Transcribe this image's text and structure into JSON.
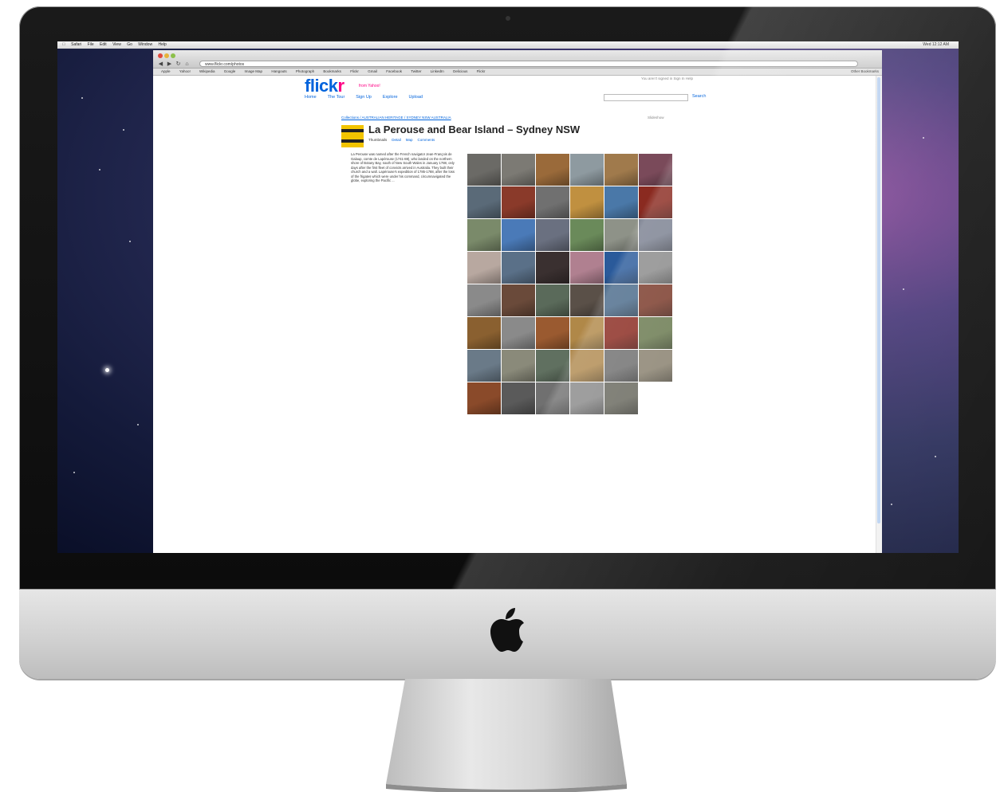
{
  "menubar": {
    "apple": "",
    "items": [
      "Safari",
      "File",
      "Edit",
      "View",
      "Go",
      "Window",
      "Help"
    ],
    "clock": "Wed 12:12 AM"
  },
  "browser": {
    "url": "www.flickr.com/photos",
    "bookmarks": [
      "Apple",
      "Yahoo!",
      "Wikipedia",
      "Google",
      "Image Map",
      "Hangouts",
      "Photograph",
      "Bookmarks",
      "Flickr",
      "Gmail",
      "Facebook",
      "Twitter",
      "LinkedIn",
      "Delicious",
      "Flickr"
    ],
    "other_bookmarks": "Other Bookmarks"
  },
  "flickr": {
    "logo_main": "flick",
    "logo_r": "r",
    "tagline": "from Yahoo!",
    "signed_in": "You aren't signed in   Sign In   Help",
    "nav": [
      "Home",
      "The Tour",
      "Sign Up",
      "Explore",
      "Upload"
    ],
    "search_button": "Search",
    "breadcrumb": "Collections / AUSTRALIAN HERITAGE / SYDNEY NSW AUSTRALIA",
    "slideshow": "Slideshow",
    "set_title": "La Perouse and Bear Island – Sydney NSW",
    "owner": "Thumbnails",
    "meta_links": [
      "Detail",
      "Map",
      "Comments"
    ],
    "description": "La Perouse was named after the French navigator Jean-François de Galaup, comte de Lapérouse (1741-88), who landed on the northern shore of Botany Bay, south of New South Wales in January 1788, only days after the first fleet of convicts arrived in Australia. They built their church and a wall. Lapérouse's expedition of 1785-1788, after the loss of the frigates which were under his command, circumnavigated the globe, exploring the Pacific ..."
  },
  "thumbnail_colors": [
    [
      "#6b6a66",
      "#7c7a74",
      "#9a6a3a",
      "#8e9aa0",
      "#a07a4c",
      "#7a4a5a"
    ],
    [
      "#5a6a78",
      "#8a3a2a",
      "#707070",
      "#c09040",
      "#4a78a8",
      "#8a2a20"
    ],
    [
      "#7a8a6a",
      "#4a7ab8",
      "#6a7080",
      "#6a8a5a",
      "#8e9288",
      "#7a8090"
    ],
    [
      "#b8a8a0",
      "#5a7088",
      "#3a3030",
      "#b08090",
      "#2a5a9a",
      "#8a8a8a"
    ],
    [
      "#8a8a8a",
      "#6a4a3a",
      "#5a6a5a",
      "#5a5048",
      "#4a6a8a",
      "#7a3a2a"
    ],
    [
      "#8a6030",
      "#8a8a8a",
      "#9a5a30",
      "#b08848",
      "#8a2a20",
      "#6a7a50"
    ],
    [
      "#6a7a88",
      "#8a8a7a",
      "#607060",
      "#b08a50",
      "#707070",
      "#8a8270"
    ],
    [
      "#8a4a2a",
      "#5a5a5a",
      "#707070",
      "#8a8a8a",
      "#6a6a60"
    ]
  ]
}
